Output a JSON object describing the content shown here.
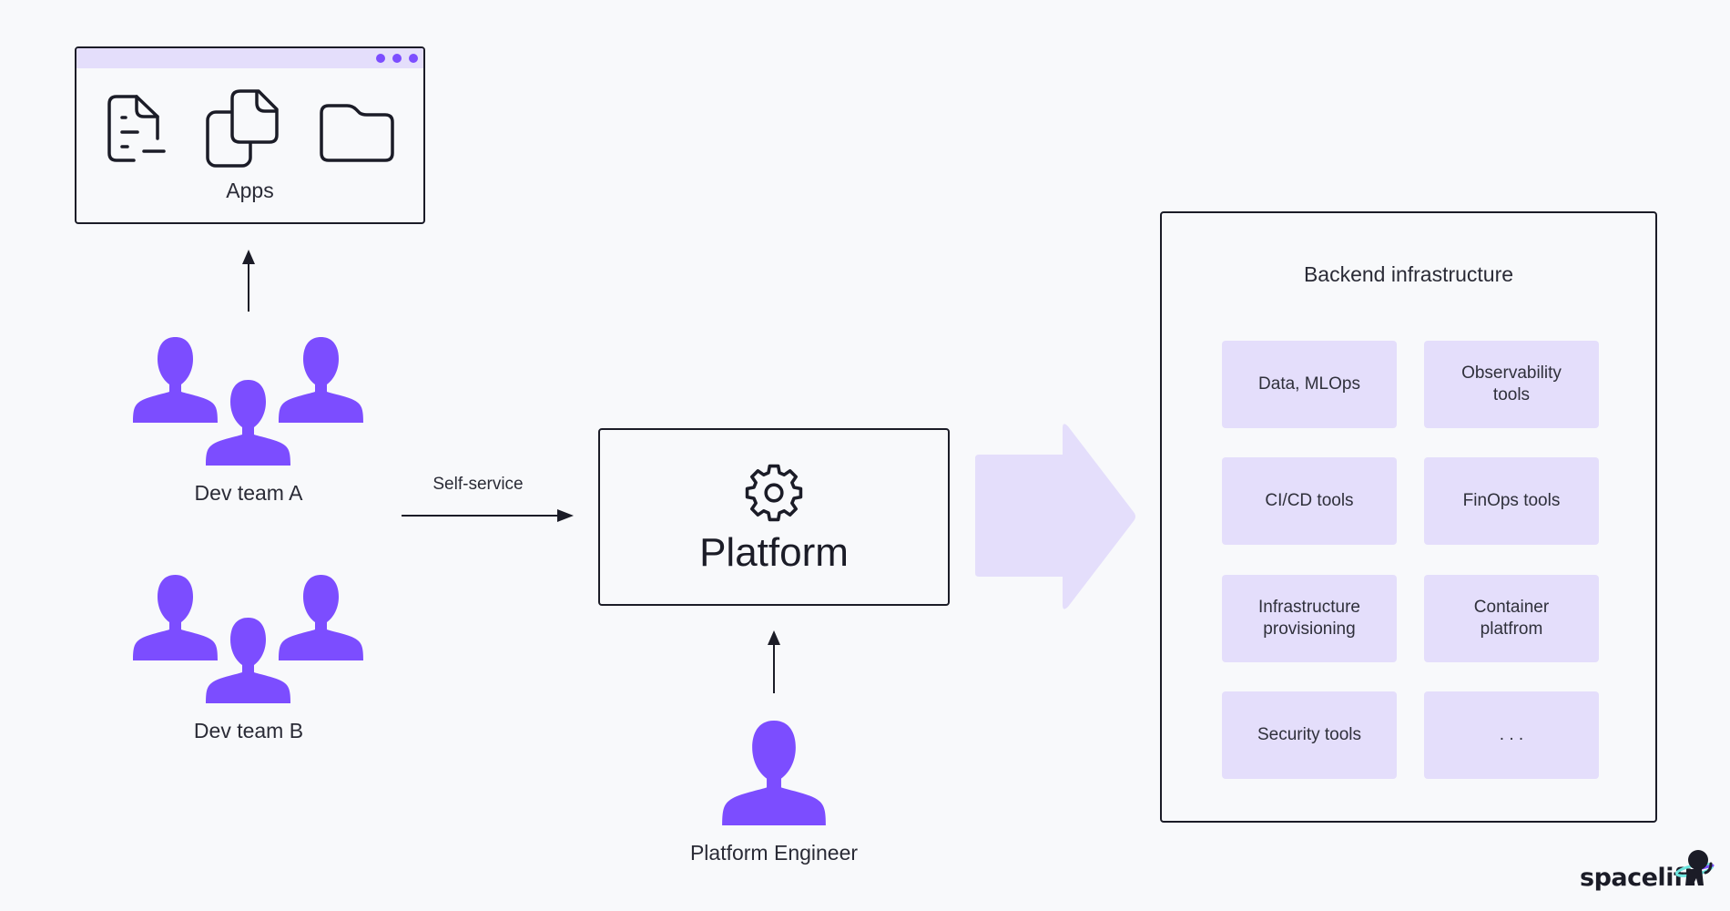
{
  "apps": {
    "label": "Apps",
    "icons": [
      "document-icon",
      "copy-files-icon",
      "folder-icon"
    ],
    "titlebar_dots": 3
  },
  "teams": [
    {
      "label": "Dev team A"
    },
    {
      "label": "Dev team B"
    }
  ],
  "self_service_label": "Self-service",
  "platform": {
    "label": "Platform",
    "icon": "gear-icon"
  },
  "platform_engineer": {
    "label": "Platform Engineer"
  },
  "backend": {
    "title": "Backend infrastructure",
    "tiles": [
      "Data, MLOps",
      "Observability\ntools",
      "CI/CD tools",
      "FinOps tools",
      "Infrastructure\nprovisioning",
      "Container\nplatfrom",
      "Security tools",
      ". . ."
    ]
  },
  "brand": {
    "name": "spacelift"
  },
  "colors": {
    "accent": "#7c4dff",
    "tile_bg": "#e4defb",
    "arrow_fill": "#e4defb",
    "stroke": "#1b1c27",
    "background": "#f8f9fb"
  }
}
